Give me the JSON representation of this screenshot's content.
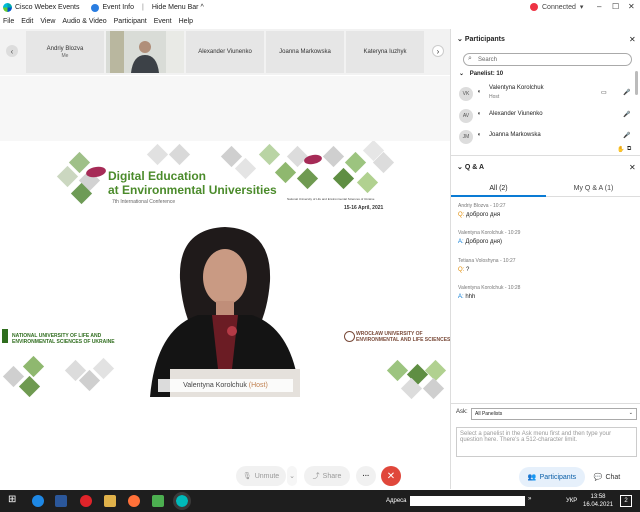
{
  "titlebar": {
    "app_title": "Cisco Webex Events",
    "event_info": "Event Info",
    "hide_menu": "Hide Menu Bar",
    "hide_menu_caret": "^",
    "status": "Connected",
    "caret": "▾"
  },
  "menu": [
    "File",
    "Edit",
    "View",
    "Audio & Video",
    "Participant",
    "Event",
    "Help"
  ],
  "filmstrip": [
    {
      "name": "Andriy Blozva",
      "sub": "Me"
    },
    {
      "name": "",
      "sub": ""
    },
    {
      "name": "Alexander Viunenko",
      "sub": ""
    },
    {
      "name": "Joanna Markowska",
      "sub": ""
    },
    {
      "name": "Kateryna Iuzhyk",
      "sub": ""
    }
  ],
  "slide": {
    "title_line1": "Digital Education",
    "title_line2": "at Environmental Universities",
    "subtitle": "7th International Conference",
    "university": "National University of Life and Environmental Sciences of Ukraine",
    "date": "15-16 April, 2021",
    "left_logo_text": "NATIONAL UNIVERSITY OF LIFE AND ENVIRONMENTAL SCIENCES OF UKRAINE",
    "right_logo_text": "WROCŁAW UNIVERSITY OF ENVIRONMENTAL AND LIFE SCIENCES"
  },
  "active_speaker": {
    "name": "Valentyna Korolchuk",
    "role": "(Host)"
  },
  "controls": {
    "unmute": "Unmute",
    "share": "Share",
    "more": "···",
    "participants": "Participants",
    "chat": "Chat"
  },
  "participants_panel": {
    "title": "Participants",
    "search_placeholder": "Search",
    "group_label": "Panelist: 10",
    "rows": [
      {
        "initials": "VK",
        "name": "Valentyna Korolchuk",
        "role": "Host"
      },
      {
        "initials": "AV",
        "name": "Alexander Viunenko",
        "role": ""
      },
      {
        "initials": "JM",
        "name": "Joanna Markowska",
        "role": ""
      }
    ]
  },
  "qa_panel": {
    "title": "Q & A",
    "tab_all": "All (2)",
    "tab_my": "My Q & A (1)",
    "q_prefix": "Q:",
    "a_prefix": "A:",
    "items": [
      {
        "meta": "Andriy Blozva - 10:27",
        "q": "доброго дня"
      },
      {
        "meta": "Valentyna Korolchuk - 10:29",
        "a": "Доброго дня)"
      },
      {
        "meta": "Tetiana Voloshyna - 10:27",
        "q": "?"
      },
      {
        "meta": "Valentyna Korolchuk - 10:28",
        "a": "hhh"
      }
    ],
    "ask_label": "Ask:",
    "ask_value": "All Panelists",
    "ask_placeholder": "Select a panelist in the Ask menu first and then type your question here. There's a 512-character limit."
  },
  "taskbar": {
    "address": "Адреса",
    "lang": "УКР",
    "time": "13:58",
    "date": "16.04.2021",
    "notif": "2"
  },
  "colors": {
    "accent": "#0a7bd4",
    "green": "#4b8b2b",
    "end_call": "#e0473b"
  }
}
